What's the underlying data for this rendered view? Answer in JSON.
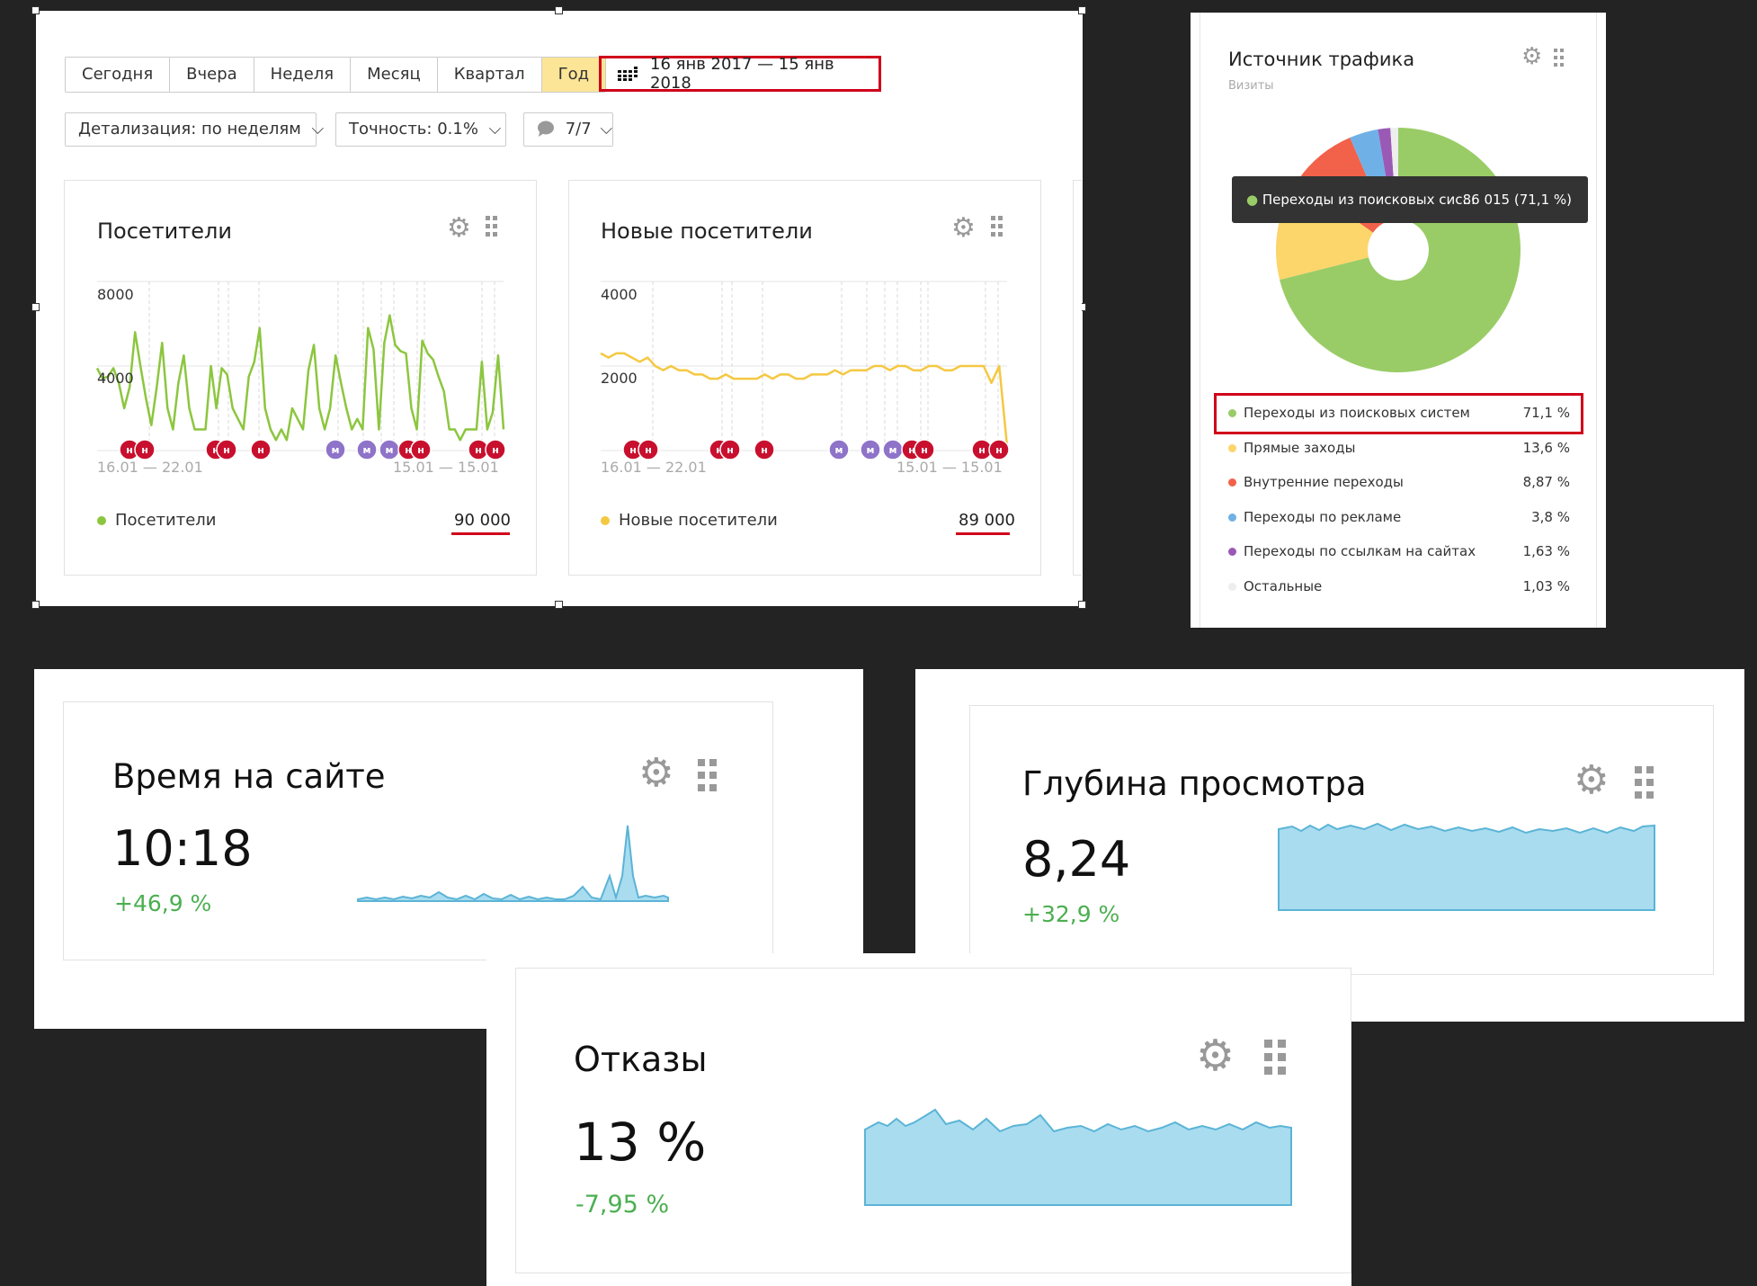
{
  "toolbar": {
    "periods": [
      "Сегодня",
      "Вчера",
      "Неделя",
      "Месяц",
      "Квартал",
      "Год"
    ],
    "date_range": "16 янв 2017 — 15 янв 2018",
    "detail": "Детализация: по неделям",
    "accuracy": "Точность: 0.1%",
    "comments": "7/7"
  },
  "visitors": {
    "title": "Посетители",
    "y_ticks": [
      "8000",
      "4000"
    ],
    "x_start": "16.01 — 22.01",
    "x_end": "15.01 — 15.01",
    "legend": "Посетители",
    "total": "90 000",
    "color": "#8cc63f"
  },
  "new_visitors": {
    "title": "Новые посетители",
    "y_ticks": [
      "4000",
      "2000"
    ],
    "x_start": "16.01 — 22.01",
    "x_end": "15.01 — 15.01",
    "legend": "Новые посетители",
    "total": "89 000",
    "color": "#f5c842"
  },
  "traffic": {
    "title": "Источник трафика",
    "subtitle": "Визиты",
    "tooltip_label": "Переходы из поисковых сис...",
    "tooltip_value": "86 015 (71,1 %)",
    "rows": [
      {
        "label": "Переходы из поисковых систем",
        "pct": "71,1 %",
        "color": "#99cc66"
      },
      {
        "label": "Прямые заходы",
        "pct": "13,6 %",
        "color": "#fcd56b"
      },
      {
        "label": "Внутренние переходы",
        "pct": "8,87 %",
        "color": "#f26149"
      },
      {
        "label": "Переходы по рекламе",
        "pct": "3,8 %",
        "color": "#6fb1e6"
      },
      {
        "label": "Переходы по ссылкам на сайтах",
        "pct": "1,63 %",
        "color": "#9b59b6"
      },
      {
        "label": "Остальные",
        "pct": "1,03 %",
        "color": "#eeeeee"
      }
    ]
  },
  "time_on_site": {
    "title": "Время на сайте",
    "value": "10:18",
    "delta": "+46,9 %"
  },
  "depth": {
    "title": "Глубина просмотра",
    "value": "8,24",
    "delta": "+32,9 %"
  },
  "bounces": {
    "title": "Отказы",
    "value": "13 %",
    "delta": "-7,95 %"
  },
  "chart_data": [
    {
      "type": "line",
      "title": "Посетители",
      "ylim": [
        0,
        8000
      ],
      "series": [
        {
          "name": "Посетители",
          "values": [
            3900,
            3400,
            3500,
            3900,
            3200,
            2000,
            3000,
            5600,
            4000,
            2500,
            1200,
            3000,
            5100,
            2000,
            1000,
            3200,
            4500,
            2000,
            1000,
            1000,
            1000,
            4000,
            2000,
            3900,
            3600,
            2000,
            1500,
            1000,
            3500,
            4200,
            5800,
            2000,
            1000,
            500,
            1000,
            500,
            2000,
            1500,
            1000,
            3800,
            5000,
            2000,
            1000,
            2000,
            4500,
            3200,
            2000,
            1000,
            1500,
            1000,
            5800,
            4800,
            1000,
            5100,
            6400,
            5000,
            4700,
            4600,
            2000,
            1000,
            5200,
            4600,
            4300,
            3500,
            2800,
            1000,
            1000,
            500,
            1000,
            1000,
            1000,
            4200,
            1000,
            1800,
            4500,
            1000
          ]
        }
      ]
    },
    {
      "type": "line",
      "title": "Новые посетители",
      "ylim": [
        0,
        4000
      ],
      "series": [
        {
          "name": "Новые посетители",
          "values": [
            2300,
            2200,
            2300,
            2300,
            2200,
            2100,
            2200,
            2000,
            1900,
            2000,
            1900,
            1900,
            1800,
            1800,
            1700,
            1700,
            1800,
            1700,
            1700,
            1700,
            1700,
            1800,
            1700,
            1800,
            1800,
            1700,
            1700,
            1800,
            1800,
            1800,
            1900,
            1800,
            1900,
            1900,
            1900,
            2000,
            2000,
            1900,
            2000,
            2000,
            1900,
            1900,
            2000,
            2000,
            1900,
            1900,
            2000,
            2000,
            2000,
            2000,
            1600,
            2000,
            100
          ]
        }
      ]
    }
  ]
}
